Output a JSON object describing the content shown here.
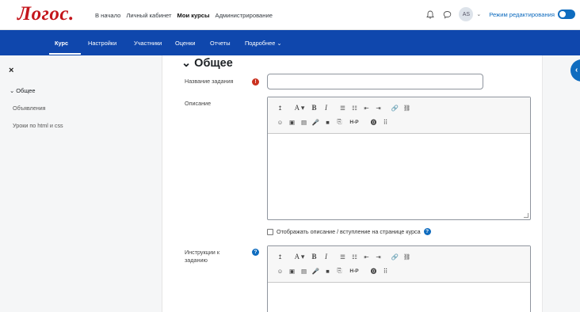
{
  "brand": {
    "logo": "Логос."
  },
  "topnav": {
    "items": [
      "В начало",
      "Личный кабинет",
      "Мои курсы",
      "Администрирование"
    ],
    "active_index": 2
  },
  "topright": {
    "bell_icon": "bell-icon",
    "chat_icon": "chat-icon",
    "avatar_initials": "AS",
    "chevron": "⌄",
    "edit_mode_label": "Режим редактирования",
    "edit_mode_on": true
  },
  "secnav": {
    "tabs": [
      "Курс",
      "Настройки",
      "Участники",
      "Оценки",
      "Отчеты",
      "Подробнее ⌄"
    ],
    "active_index": 0
  },
  "drawer": {
    "close": "×",
    "section": "⌄ Общее",
    "items": [
      "Объявления",
      "Уроки по html и css"
    ]
  },
  "form": {
    "section_title": "⌄ Общее",
    "name_label": "Название задания",
    "description_label": "Описание",
    "show_description_label": "Отображать описание / вступление на странице курса",
    "instructions_label": "Инструкции к заданию",
    "required_icon": "!",
    "help_icon": "?"
  },
  "editor_toolbar": {
    "row1": [
      "↥",
      "A ▾",
      "B",
      "I",
      "☰",
      "☷",
      "⇤",
      "⇥",
      "🔗",
      "⛓"
    ],
    "row2": [
      "☺",
      "▣",
      "▤",
      "🎤",
      "■",
      "⎘",
      "H-P",
      "⓿",
      "⠿"
    ]
  },
  "colors": {
    "brand_red": "#c4161c",
    "nav_blue": "#0f47ad",
    "accent": "#0f6cbf"
  }
}
